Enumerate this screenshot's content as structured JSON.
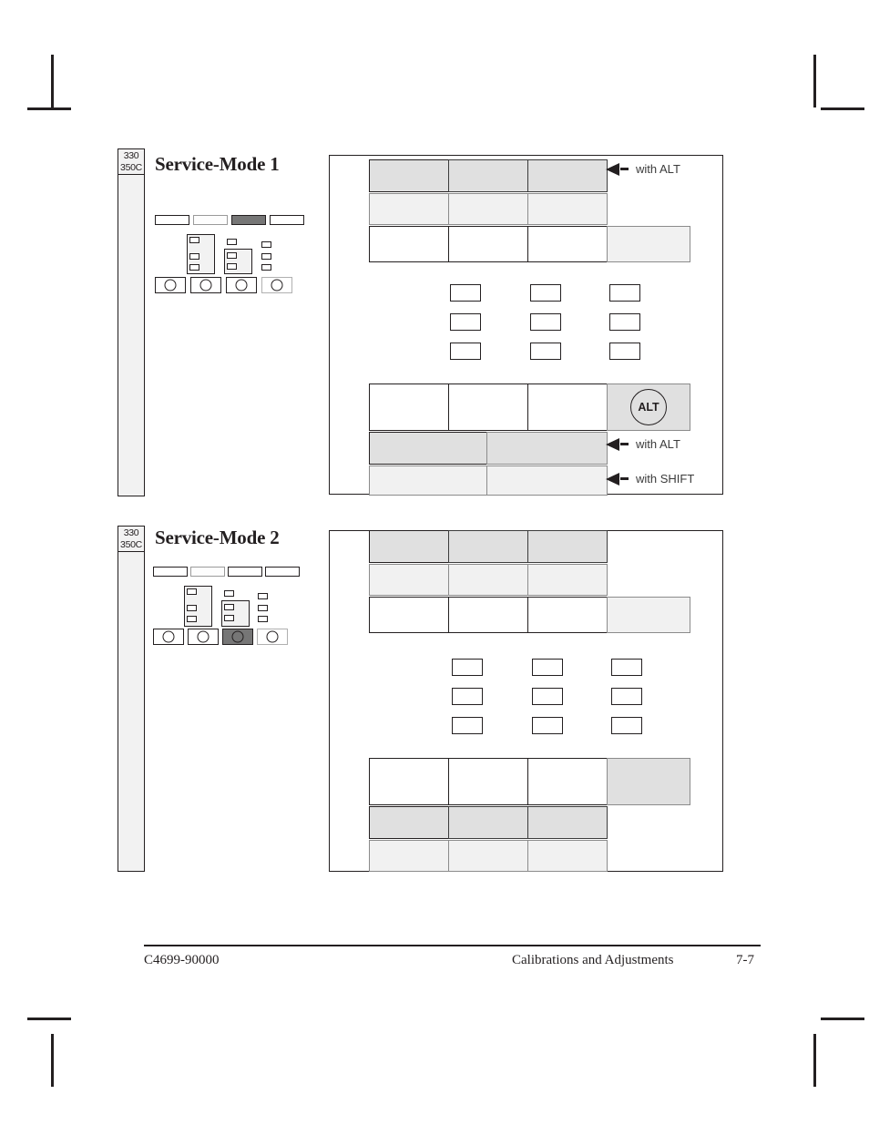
{
  "document": {
    "footer": {
      "part_number": "C4699-90000",
      "chapter_title": "Calibrations and Adjustments",
      "page_number": "7-7"
    }
  },
  "sections": [
    {
      "id": "service-mode-1",
      "model_label_line1": "330",
      "model_label_line2": "350C",
      "title": "Service-Mode 1",
      "panel_thumbnail": {
        "bars": [
          {
            "style": "plain"
          },
          {
            "style": "light"
          },
          {
            "style": "dark"
          },
          {
            "style": "plain"
          }
        ],
        "keys": [
          {
            "style": "plain"
          },
          {
            "style": "plain"
          },
          {
            "style": "plain"
          },
          {
            "style": "light"
          }
        ]
      },
      "callouts": [
        {
          "text": "with ALT",
          "row": "top"
        },
        {
          "text": "with ALT",
          "row": "bottom-1"
        },
        {
          "text": "with SHIFT",
          "row": "bottom-2"
        }
      ],
      "alt_key_label": "ALT",
      "top_rows": [
        {
          "fill": "gray",
          "cells": 3
        },
        {
          "fill": "ltgray",
          "cells": 3
        },
        {
          "fill": "white",
          "cells": 3,
          "trailing": "ltgray"
        }
      ],
      "bottom_rows": [
        {
          "fill": "white",
          "cells": 3,
          "trailing": "gray-alt"
        },
        {
          "fill": "gray",
          "cells": 3
        },
        {
          "fill": "ltgray",
          "cells": 3
        }
      ],
      "key_grid": {
        "rows": 3,
        "cols": 3
      }
    },
    {
      "id": "service-mode-2",
      "model_label_line1": "330",
      "model_label_line2": "350C",
      "title": "Service-Mode 2",
      "panel_thumbnail": {
        "bars": [
          {
            "style": "plain"
          },
          {
            "style": "light"
          },
          {
            "style": "plain"
          },
          {
            "style": "plain"
          }
        ],
        "keys": [
          {
            "style": "plain"
          },
          {
            "style": "plain"
          },
          {
            "style": "dark"
          },
          {
            "style": "light"
          }
        ]
      },
      "callouts": [],
      "alt_key_label": "",
      "top_rows": [
        {
          "fill": "gray",
          "cells": 3
        },
        {
          "fill": "ltgray",
          "cells": 3
        },
        {
          "fill": "white",
          "cells": 3,
          "trailing": "ltgray"
        }
      ],
      "bottom_rows": [
        {
          "fill": "white",
          "cells": 3,
          "trailing": "gray"
        },
        {
          "fill": "gray",
          "cells": 3
        },
        {
          "fill": "ltgray",
          "cells": 3
        }
      ],
      "key_grid": {
        "rows": 3,
        "cols": 3
      }
    }
  ],
  "colors": {
    "ink": "#231f20",
    "gray_row": "#e0e0e0",
    "light_row": "#f1f1f1",
    "tab_fill": "#f2f2f2",
    "dark_key": "#767676"
  }
}
